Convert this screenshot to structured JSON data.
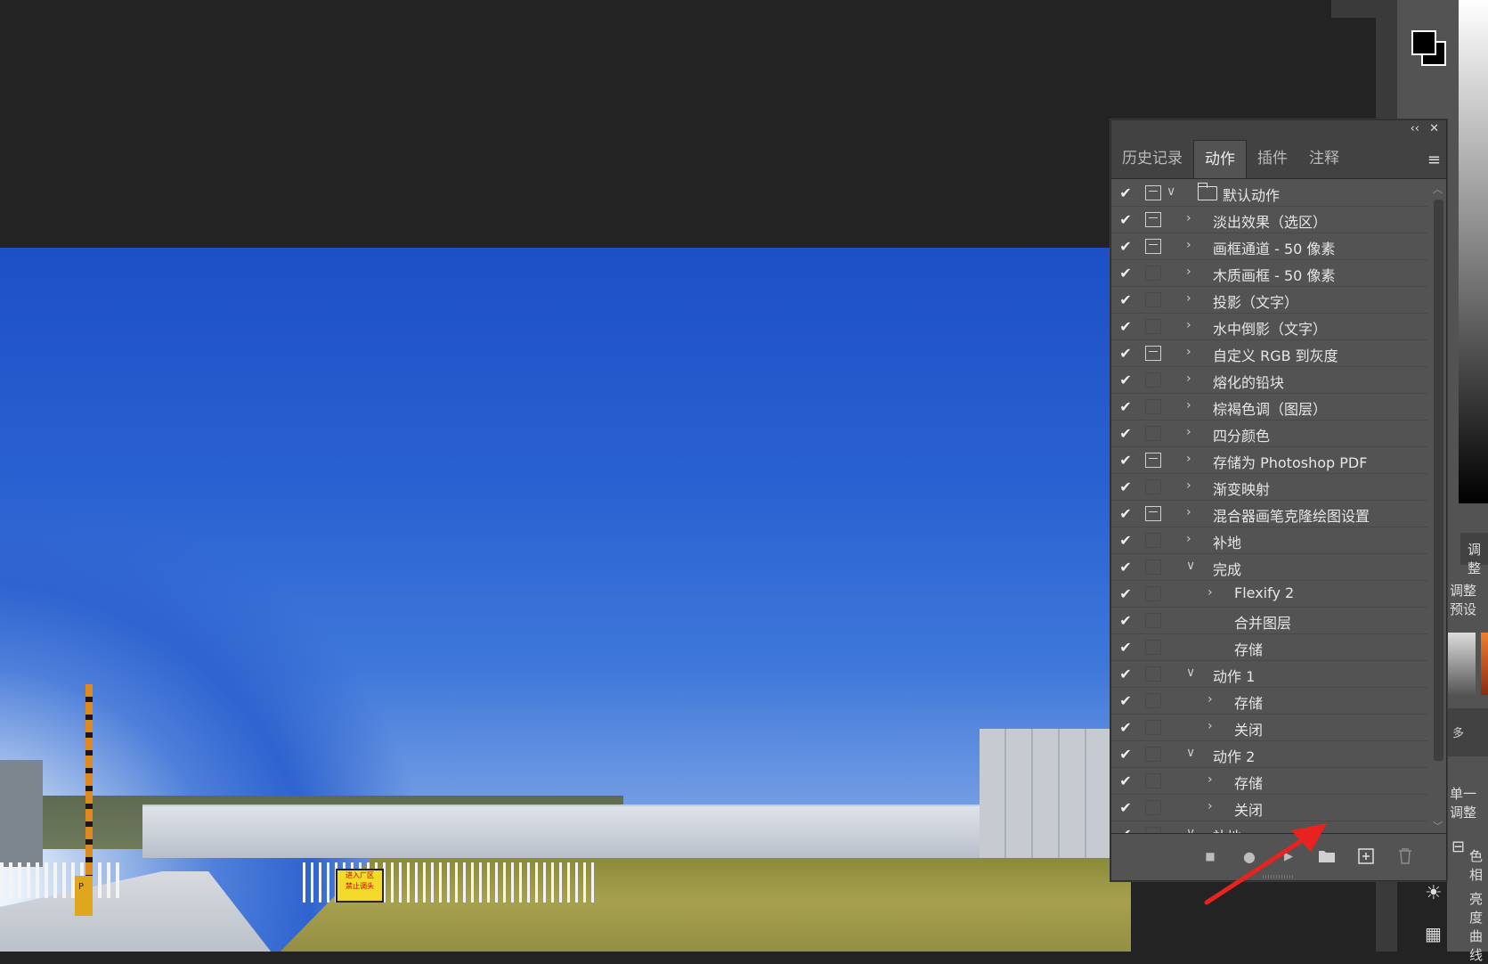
{
  "actions_panel": {
    "tabs": [
      {
        "label": "历史记录",
        "active": false
      },
      {
        "label": "动作",
        "active": true
      },
      {
        "label": "插件",
        "active": false
      },
      {
        "label": "注释",
        "active": false
      }
    ],
    "collapse_label": "‹‹",
    "close_label": "✕",
    "menu_icon": "panel-menu-icon",
    "rows": [
      {
        "check": "✔",
        "dialog": "on",
        "expand": "∨",
        "level": 0,
        "folder": true,
        "label": "默认动作"
      },
      {
        "check": "✔",
        "dialog": "on",
        "expand": "›",
        "level": 1,
        "label": "淡出效果（选区）"
      },
      {
        "check": "✔",
        "dialog": "on",
        "expand": "›",
        "level": 1,
        "label": "画框通道 - 50 像素"
      },
      {
        "check": "✔",
        "dialog": "off",
        "expand": "›",
        "level": 1,
        "label": "木质画框 - 50 像素"
      },
      {
        "check": "✔",
        "dialog": "off",
        "expand": "›",
        "level": 1,
        "label": "投影（文字）"
      },
      {
        "check": "✔",
        "dialog": "off",
        "expand": "›",
        "level": 1,
        "label": "水中倒影（文字）"
      },
      {
        "check": "✔",
        "dialog": "on",
        "expand": "›",
        "level": 1,
        "label": "自定义 RGB 到灰度"
      },
      {
        "check": "✔",
        "dialog": "off",
        "expand": "›",
        "level": 1,
        "label": "熔化的铅块"
      },
      {
        "check": "✔",
        "dialog": "off",
        "expand": "›",
        "level": 1,
        "label": "棕褐色调（图层）"
      },
      {
        "check": "✔",
        "dialog": "off",
        "expand": "›",
        "level": 1,
        "label": "四分颜色"
      },
      {
        "check": "✔",
        "dialog": "box",
        "expand": "›",
        "level": 1,
        "label": "存储为 Photoshop PDF"
      },
      {
        "check": "✔",
        "dialog": "off",
        "expand": "›",
        "level": 1,
        "label": "渐变映射"
      },
      {
        "check": "✔",
        "dialog": "on",
        "expand": "›",
        "level": 1,
        "label": "混合器画笔克隆绘图设置"
      },
      {
        "check": "✔",
        "dialog": "off",
        "expand": "›",
        "level": 1,
        "label": "补地"
      },
      {
        "check": "✔",
        "dialog": "off",
        "expand": "∨",
        "level": 1,
        "label": "完成"
      },
      {
        "check": "✔",
        "dialog": "off",
        "expand": "›",
        "level": 2,
        "label": "Flexify 2"
      },
      {
        "check": "✔",
        "dialog": "off",
        "expand": "",
        "level": 2,
        "label": "合并图层"
      },
      {
        "check": "✔",
        "dialog": "off",
        "expand": "",
        "level": 2,
        "label": "存储"
      },
      {
        "check": "✔",
        "dialog": "off",
        "expand": "∨",
        "level": 1,
        "label": "动作 1"
      },
      {
        "check": "✔",
        "dialog": "off",
        "expand": "›",
        "level": 2,
        "label": "存储"
      },
      {
        "check": "✔",
        "dialog": "off",
        "expand": "›",
        "level": 2,
        "label": "关闭"
      },
      {
        "check": "✔",
        "dialog": "off",
        "expand": "∨",
        "level": 1,
        "label": "动作 2"
      },
      {
        "check": "✔",
        "dialog": "off",
        "expand": "›",
        "level": 2,
        "label": "存储"
      },
      {
        "check": "✔",
        "dialog": "off",
        "expand": "›",
        "level": 2,
        "label": "关闭"
      },
      {
        "check": "✔",
        "dialog": "off",
        "expand": "∨",
        "level": 1,
        "label": "补地"
      }
    ],
    "bottom_buttons": [
      {
        "name": "stop-button",
        "icon": "stop-icon",
        "glyph": "■"
      },
      {
        "name": "record-button",
        "icon": "record-icon",
        "glyph": "●"
      },
      {
        "name": "play-button",
        "icon": "play-icon",
        "glyph": "▶"
      },
      {
        "name": "new-set-button",
        "icon": "folder-icon",
        "glyph": "📁"
      },
      {
        "name": "new-action-button",
        "icon": "new-action-icon",
        "glyph": "⊞"
      },
      {
        "name": "delete-button",
        "icon": "trash-icon",
        "glyph": "🗑"
      }
    ]
  },
  "adjustments_panel": {
    "tab_label": "调整",
    "presets_label": "调整预设",
    "more_label": "多",
    "single_adjust_label": "单一调整",
    "items": [
      {
        "icon": "color-balance-icon",
        "label": "色相"
      },
      {
        "icon": "brightness-icon",
        "label": "亮度"
      },
      {
        "icon": "curves-icon",
        "label": "曲线"
      }
    ]
  },
  "colors": {
    "panel_bg": "#535353",
    "tab_bar_bg": "#424242",
    "canvas_bg": "#232323",
    "annotation_arrow": "#e8231f"
  },
  "photo": {
    "sign_text_1": "进入厂区",
    "sign_text_2": "禁止调头",
    "gate_letter": "P"
  }
}
